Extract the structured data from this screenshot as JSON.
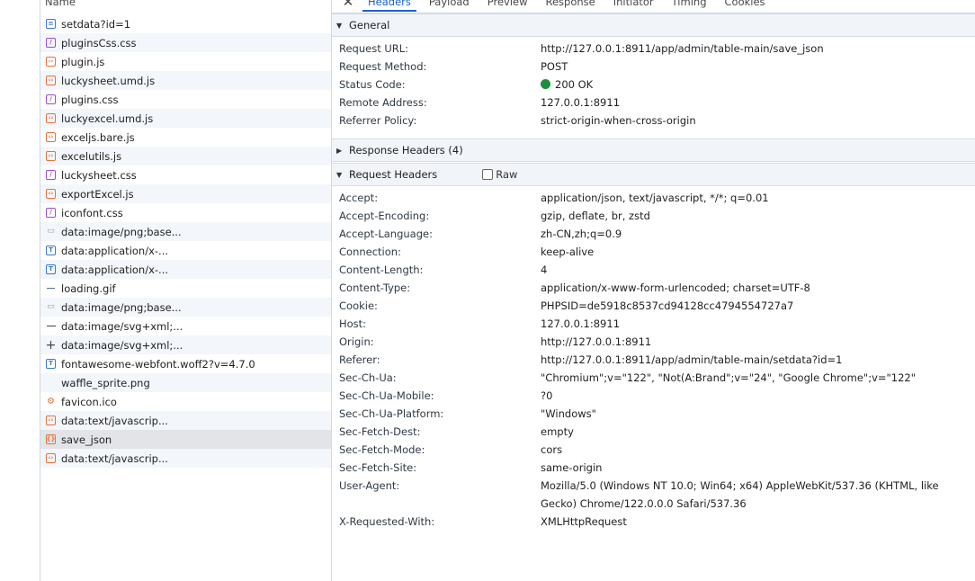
{
  "request_list": {
    "header": "Name",
    "items": [
      {
        "icon": "doc-icon",
        "name": "setdata?id=1"
      },
      {
        "icon": "css-icon",
        "name": "pluginsCss.css"
      },
      {
        "icon": "js-icon",
        "name": "plugin.js"
      },
      {
        "icon": "js-icon",
        "name": "luckysheet.umd.js"
      },
      {
        "icon": "css-icon",
        "name": "plugins.css"
      },
      {
        "icon": "js-icon",
        "name": "luckyexcel.umd.js"
      },
      {
        "icon": "js-icon",
        "name": "exceljs.bare.js"
      },
      {
        "icon": "js-icon",
        "name": "excelutils.js"
      },
      {
        "icon": "css-icon",
        "name": "luckysheet.css"
      },
      {
        "icon": "js-icon",
        "name": "exportExcel.js"
      },
      {
        "icon": "css-icon",
        "name": "iconfont.css"
      },
      {
        "icon": "image-icon",
        "name": "data:image/png;base..."
      },
      {
        "icon": "font-icon",
        "name": "data:application/x-..."
      },
      {
        "icon": "font-icon",
        "name": "data:application/x-..."
      },
      {
        "icon": "gif-icon",
        "name": "loading.gif"
      },
      {
        "icon": "image-icon",
        "name": "data:image/png;base..."
      },
      {
        "icon": "line-icon",
        "name": "data:image/svg+xml;..."
      },
      {
        "icon": "plus-icon",
        "name": "data:image/svg+xml;..."
      },
      {
        "icon": "font-icon",
        "name": "fontawesome-webfont.woff2?v=4.7.0"
      },
      {
        "icon": "blank-icon",
        "name": "waffle_sprite.png"
      },
      {
        "icon": "favicon-icon",
        "name": "favicon.ico"
      },
      {
        "icon": "js-icon",
        "name": "data:text/javascrip..."
      },
      {
        "icon": "fetch-icon",
        "name": "save_json"
      },
      {
        "icon": "js-icon",
        "name": "data:text/javascrip..."
      }
    ],
    "selected_index": 22
  },
  "tabs": {
    "close": "✕",
    "items": [
      "Headers",
      "Payload",
      "Preview",
      "Response",
      "Initiator",
      "Timing",
      "Cookies"
    ],
    "active": "Headers"
  },
  "general": {
    "title": "General",
    "rows": [
      {
        "key": "Request URL:",
        "value": "http://127.0.0.1:8911/app/admin/table-main/save_json"
      },
      {
        "key": "Request Method:",
        "value": "POST"
      },
      {
        "key": "Status Code:",
        "value": "200 OK"
      },
      {
        "key": "Remote Address:",
        "value": "127.0.0.1:8911"
      },
      {
        "key": "Referrer Policy:",
        "value": "strict-origin-when-cross-origin"
      }
    ],
    "status_color": "#1e8e3e"
  },
  "response_headers": {
    "title": "Response Headers (4)"
  },
  "request_headers": {
    "title": "Request Headers",
    "raw_label": "Raw",
    "rows": [
      {
        "key": "Accept:",
        "value": "application/json, text/javascript, */*; q=0.01"
      },
      {
        "key": "Accept-Encoding:",
        "value": "gzip, deflate, br, zstd"
      },
      {
        "key": "Accept-Language:",
        "value": "zh-CN,zh;q=0.9"
      },
      {
        "key": "Connection:",
        "value": "keep-alive"
      },
      {
        "key": "Content-Length:",
        "value": "4"
      },
      {
        "key": "Content-Type:",
        "value": "application/x-www-form-urlencoded; charset=UTF-8"
      },
      {
        "key": "Cookie:",
        "value": "PHPSID=de5918c8537cd94128cc4794554727a7"
      },
      {
        "key": "Host:",
        "value": "127.0.0.1:8911"
      },
      {
        "key": "Origin:",
        "value": "http://127.0.0.1:8911"
      },
      {
        "key": "Referer:",
        "value": "http://127.0.0.1:8911/app/admin/table-main/setdata?id=1"
      },
      {
        "key": "Sec-Ch-Ua:",
        "value": "\"Chromium\";v=\"122\", \"Not(A:Brand\";v=\"24\", \"Google Chrome\";v=\"122\""
      },
      {
        "key": "Sec-Ch-Ua-Mobile:",
        "value": "?0"
      },
      {
        "key": "Sec-Ch-Ua-Platform:",
        "value": "\"Windows\""
      },
      {
        "key": "Sec-Fetch-Dest:",
        "value": "empty"
      },
      {
        "key": "Sec-Fetch-Mode:",
        "value": "cors"
      },
      {
        "key": "Sec-Fetch-Site:",
        "value": "same-origin"
      },
      {
        "key": "User-Agent:",
        "value": "Mozilla/5.0 (Windows NT 10.0; Win64; x64) AppleWebKit/537.36 (KHTML, like Gecko) Chrome/122.0.0.0 Safari/537.36"
      },
      {
        "key": "X-Requested-With:",
        "value": "XMLHttpRequest"
      }
    ]
  },
  "colors": {
    "accent": "#1a61d2",
    "section_bg": "#f1f4f9",
    "selected_row": "#e2e4e8"
  }
}
